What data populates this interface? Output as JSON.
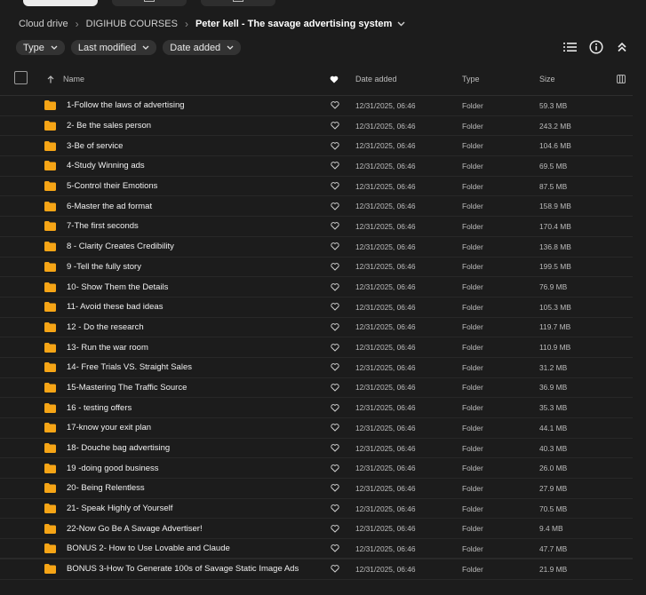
{
  "breadcrumb": {
    "items": [
      "Cloud drive",
      "DIGIHUB COURSES"
    ],
    "current": "Peter kell - The savage advertising system"
  },
  "filters": [
    {
      "label": "Type"
    },
    {
      "label": "Last modified"
    },
    {
      "label": "Date added"
    }
  ],
  "toolbar": {
    "icons": [
      "list-view-icon",
      "info-icon",
      "collapse-icon"
    ]
  },
  "table": {
    "columns": {
      "name": "Name",
      "date_added": "Date added",
      "type": "Type",
      "size": "Size"
    },
    "rows": [
      {
        "name": "1-Follow the laws of advertising",
        "date": "12/31/2025, 06:46",
        "type": "Folder",
        "size": "59.3 MB"
      },
      {
        "name": "2- Be the sales person",
        "date": "12/31/2025, 06:46",
        "type": "Folder",
        "size": "243.2 MB"
      },
      {
        "name": "3-Be of service",
        "date": "12/31/2025, 06:46",
        "type": "Folder",
        "size": "104.6 MB"
      },
      {
        "name": "4-Study Winning ads",
        "date": "12/31/2025, 06:46",
        "type": "Folder",
        "size": "69.5 MB"
      },
      {
        "name": "5-Control their Emotions",
        "date": "12/31/2025, 06:46",
        "type": "Folder",
        "size": "87.5 MB"
      },
      {
        "name": "6-Master the ad format",
        "date": "12/31/2025, 06:46",
        "type": "Folder",
        "size": "158.9 MB"
      },
      {
        "name": "7-The first seconds",
        "date": "12/31/2025, 06:46",
        "type": "Folder",
        "size": "170.4 MB"
      },
      {
        "name": "8 - Clarity Creates Credibility",
        "date": "12/31/2025, 06:46",
        "type": "Folder",
        "size": "136.8 MB"
      },
      {
        "name": "9 -Tell the fully story",
        "date": "12/31/2025, 06:46",
        "type": "Folder",
        "size": "199.5 MB"
      },
      {
        "name": "10- Show Them the Details",
        "date": "12/31/2025, 06:46",
        "type": "Folder",
        "size": "76.9 MB"
      },
      {
        "name": "11- Avoid these bad ideas",
        "date": "12/31/2025, 06:46",
        "type": "Folder",
        "size": "105.3 MB"
      },
      {
        "name": "12 - Do the research",
        "date": "12/31/2025, 06:46",
        "type": "Folder",
        "size": "119.7 MB"
      },
      {
        "name": "13- Run the war room",
        "date": "12/31/2025, 06:46",
        "type": "Folder",
        "size": "110.9 MB"
      },
      {
        "name": "14- Free Trials VS. Straight Sales",
        "date": "12/31/2025, 06:46",
        "type": "Folder",
        "size": "31.2 MB"
      },
      {
        "name": "15-Mastering The Traffic Source",
        "date": "12/31/2025, 06:46",
        "type": "Folder",
        "size": "36.9 MB"
      },
      {
        "name": "16 - testing offers",
        "date": "12/31/2025, 06:46",
        "type": "Folder",
        "size": "35.3 MB"
      },
      {
        "name": "17-know your exit plan",
        "date": "12/31/2025, 06:46",
        "type": "Folder",
        "size": "44.1 MB"
      },
      {
        "name": "18- Douche bag advertising",
        "date": "12/31/2025, 06:46",
        "type": "Folder",
        "size": "40.3 MB"
      },
      {
        "name": "19 -doing good business",
        "date": "12/31/2025, 06:46",
        "type": "Folder",
        "size": "26.0 MB"
      },
      {
        "name": "20- Being Relentless",
        "date": "12/31/2025, 06:46",
        "type": "Folder",
        "size": "27.9 MB"
      },
      {
        "name": "21- Speak Highly of Yourself",
        "date": "12/31/2025, 06:46",
        "type": "Folder",
        "size": "70.5 MB"
      },
      {
        "name": "22-Now Go Be A Savage Advertiser!",
        "date": "12/31/2025, 06:46",
        "type": "Folder",
        "size": "9.4 MB"
      },
      {
        "name": "BONUS 2- How to Use Lovable and Claude",
        "date": "12/31/2025, 06:46",
        "type": "Folder",
        "size": "47.7 MB"
      },
      {
        "name": "BONUS 3-How To Generate 100s of Savage Static Image Ads",
        "date": "12/31/2025, 06:46",
        "type": "Folder",
        "size": "21.9 MB"
      }
    ]
  },
  "colors": {
    "background": "#1c1c1c",
    "folder": "#f6a516",
    "chip": "#333333"
  }
}
